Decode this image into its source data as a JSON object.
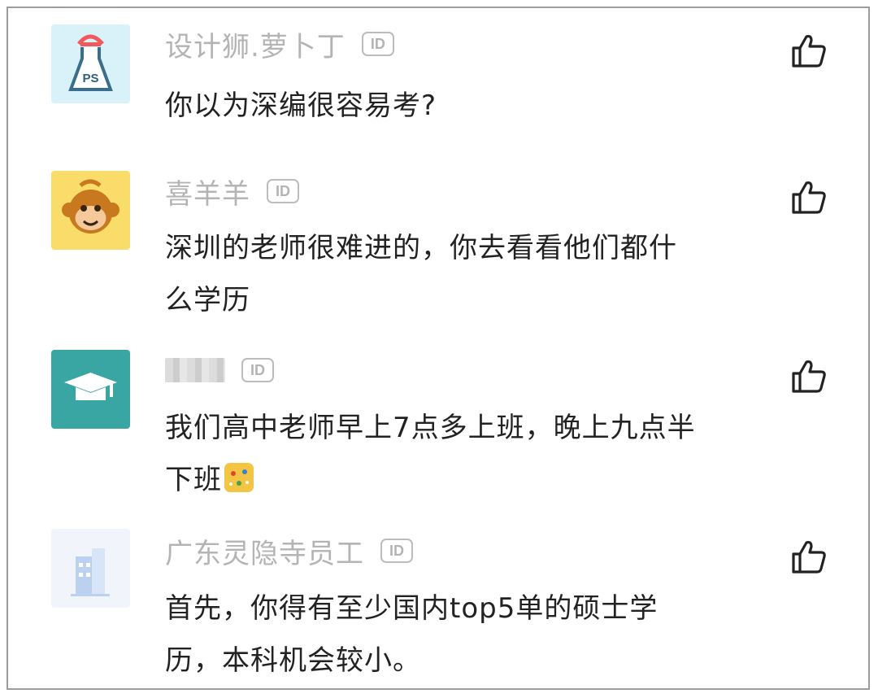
{
  "comments": [
    {
      "username": "设计狮.萝卜丁",
      "id_badge": "ID",
      "text": "你以为深编很容易考?",
      "avatar_icon": "ps-designer-avatar-icon",
      "avatar_text": "PS"
    },
    {
      "username": "喜羊羊",
      "id_badge": "ID",
      "text_line1": "深圳的老师很难进的，你去看看他们都什",
      "text_line2": "么学历",
      "avatar_icon": "monkey-avatar-icon"
    },
    {
      "username": "",
      "id_badge": "ID",
      "text_line1": "我们高中老师早上7点多上班，晚上九点半",
      "text_line2": "下班",
      "emoji": "celebrate-emoji-icon",
      "avatar_icon": "graduation-cap-avatar-icon"
    },
    {
      "username": "广东灵隐寺员工",
      "id_badge": "ID",
      "text_line1": "首先，你得有至少国内top5单的硕士学",
      "text_line2": "历，本科机会较小。",
      "avatar_icon": "building-avatar-icon"
    }
  ],
  "colors": {
    "username": "#b4b4b4",
    "text": "#222222",
    "frame_border": "#9c9c9c",
    "teal_avatar": "#3aa6a3",
    "yellow_avatar": "#f9dc6a",
    "blue_avatar": "#d9f1f9"
  },
  "like_icon": "thumbs-up-icon"
}
